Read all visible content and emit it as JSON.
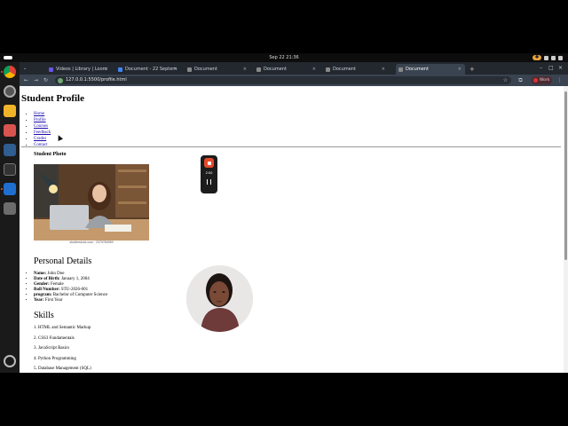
{
  "topbar": {
    "clock": "Sep 22  21:36",
    "recording_timer": "2:00"
  },
  "tabs": [
    {
      "label": "Videos | Library | Loom",
      "fav_color": "#6a55e6"
    },
    {
      "label": "Document - 22 Septem",
      "fav_color": "#4285f4"
    },
    {
      "label": "Document",
      "fav_color": "#888888"
    },
    {
      "label": "Document",
      "fav_color": "#888888"
    },
    {
      "label": "Document",
      "fav_color": "#888888"
    },
    {
      "label": "Document",
      "fav_color": "#888888",
      "active": true
    }
  ],
  "toolbar": {
    "url": "127.0.0.1:5500/profile.html",
    "profile_label": "Work"
  },
  "page": {
    "title": "Student Profile",
    "nav": [
      "Home",
      "Profile",
      "Courses",
      "Feedback",
      "Grades",
      "Contact"
    ],
    "photo_heading": "Student Photo",
    "photo_credit": "shutterstock.com · 2379784959",
    "personal_heading": "Personal Details",
    "details": [
      {
        "key": "Name:",
        "value": "John Doe"
      },
      {
        "key": "Date of Birth:",
        "value": "January 1, 2004"
      },
      {
        "key": "Gender:",
        "value": "Female"
      },
      {
        "key": "Roll Number:",
        "value": "STU-2026-001"
      },
      {
        "key": "program:",
        "value": "Bachelor of Computer Science"
      },
      {
        "key": "Year:",
        "value": "First Year"
      }
    ],
    "skills_heading": "Skills",
    "skills": [
      "1. HTML and Semantic Markup",
      "2. CSS3 Fundamentals",
      "3. JavaScript Basics",
      "4. Python Programming",
      "5. Database Management (SQL)"
    ]
  },
  "colors": {
    "accent_ubuntu": "#e95420",
    "link": "#1a0dab",
    "record": "#e54b2a"
  }
}
